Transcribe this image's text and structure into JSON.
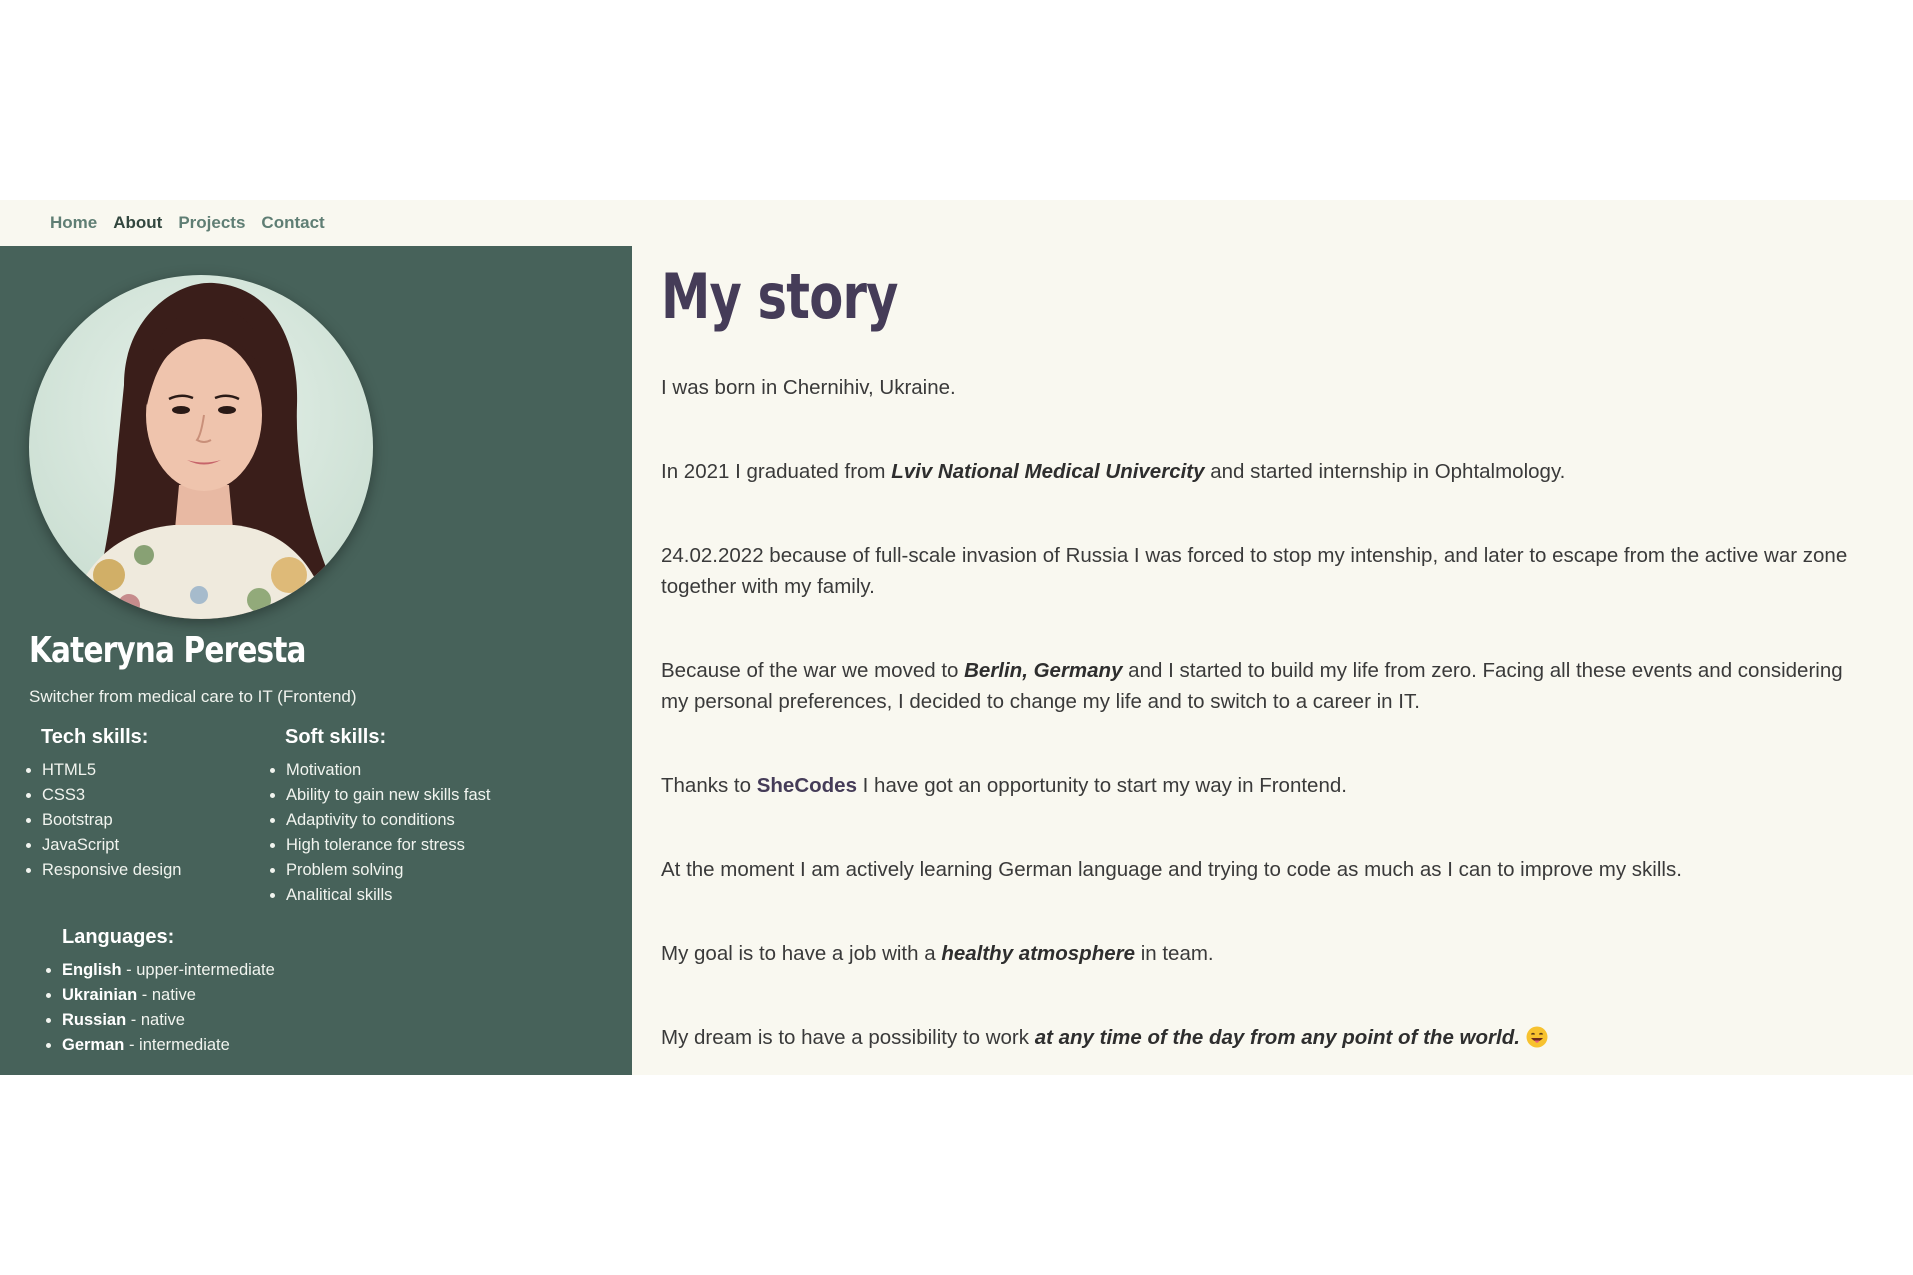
{
  "nav": {
    "items": [
      {
        "label": "Home",
        "active": false
      },
      {
        "label": "About",
        "active": true
      },
      {
        "label": "Projects",
        "active": false
      },
      {
        "label": "Contact",
        "active": false
      }
    ]
  },
  "profile": {
    "name": "Kateryna Peresta",
    "subtitle": "Switcher from medical care to IT (Frontend)"
  },
  "tech_skills": {
    "heading": "Tech skills:",
    "items": [
      "HTML5",
      "CSS3",
      "Bootstrap",
      "JavaScript",
      "Responsive design"
    ]
  },
  "soft_skills": {
    "heading": "Soft skills:",
    "items": [
      "Motivation",
      "Ability to gain new skills fast",
      "Adaptivity to conditions",
      "High tolerance for stress",
      "Problem solving",
      "Analitical skills"
    ]
  },
  "languages": {
    "heading": "Languages:",
    "items": [
      {
        "name": "English",
        "level": " - upper-intermediate"
      },
      {
        "name": "Ukrainian",
        "level": " - native"
      },
      {
        "name": "Russian",
        "level": " - native"
      },
      {
        "name": "German",
        "level": " - intermediate"
      }
    ]
  },
  "story": {
    "title": "My story",
    "p1": "I was born in Chernihiv, Ukraine.",
    "p2_a": "In 2021 I graduated from ",
    "p2_em": "Lviv National Medical Univercity",
    "p2_b": " and started internship in Ophtalmology.",
    "p3": "24.02.2022 because of full-scale invasion of Russia I was forced to stop my intenship, and later to escape from the active war zone together with my family.",
    "p4_a": "Because of the war we moved to ",
    "p4_em": "Berlin, Germany",
    "p4_b": " and I started to build my life from zero. Facing all these events and considering my personal preferences, I decided to change my life and to switch to a career in IT.",
    "p5_a": "Thanks to ",
    "p5_brand": "SheCodes",
    "p5_b": " I have got an opportunity to start my way in Frontend.",
    "p6": "At the moment I am actively learning German language and trying to code as much as I can to improve my skills.",
    "p7_a": "My goal is to have a job with a ",
    "p7_em": "healthy atmosphere",
    "p7_b": " in team.",
    "p8_a": "My dream is to have a possibility to work ",
    "p8_em": "at any time of the day from any point of the world.",
    "p8_icon": "grinning-face-tongue-emoji"
  },
  "colors": {
    "sidebar_bg": "#47625a",
    "page_bg": "#f9f8f0",
    "title_color": "#453c58",
    "nav_link": "#5f7e74",
    "nav_active": "#33473f"
  }
}
